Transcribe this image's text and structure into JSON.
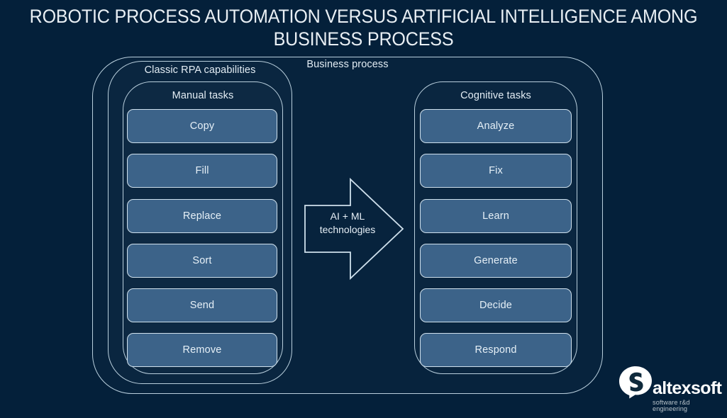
{
  "page": {
    "title": "ROBOTIC PROCESS AUTOMATION VERSUS ARTIFICIAL INTELLIGENCE AMONG\nBUSINESS PROCESS",
    "background_color": "#04203a"
  },
  "colors": {
    "background": "#04203a",
    "outline": "#b9cfdd",
    "task_fill": "#3c6389",
    "task_border": "#cfe0ec",
    "text_light": "#e6f0f7",
    "logo_white": "#ffffff",
    "logo_tagline": "#b7c2c9"
  },
  "diagram": {
    "outer_container": {
      "label": "Business process"
    },
    "left_container": {
      "label": "Classic RPA capabilities"
    },
    "left_inner_container": {
      "label": "Manual tasks",
      "tasks": [
        {
          "label": "Copy"
        },
        {
          "label": "Fill"
        },
        {
          "label": "Replace"
        },
        {
          "label": "Sort"
        },
        {
          "label": "Send"
        },
        {
          "label": "Remove"
        }
      ]
    },
    "right_container": {
      "label": "Cognitive tasks",
      "tasks": [
        {
          "label": "Analyze"
        },
        {
          "label": "Fix"
        },
        {
          "label": "Learn"
        },
        {
          "label": "Generate"
        },
        {
          "label": "Decide"
        },
        {
          "label": "Respond"
        }
      ]
    },
    "arrow": {
      "label": "AI + ML\ntechnologies",
      "direction": "right",
      "icon": "right-arrow-outline-icon"
    }
  },
  "logo": {
    "name": "altexsoft",
    "tagline": "software r&d engineering",
    "mark": "speech-bubble-a-icon"
  }
}
